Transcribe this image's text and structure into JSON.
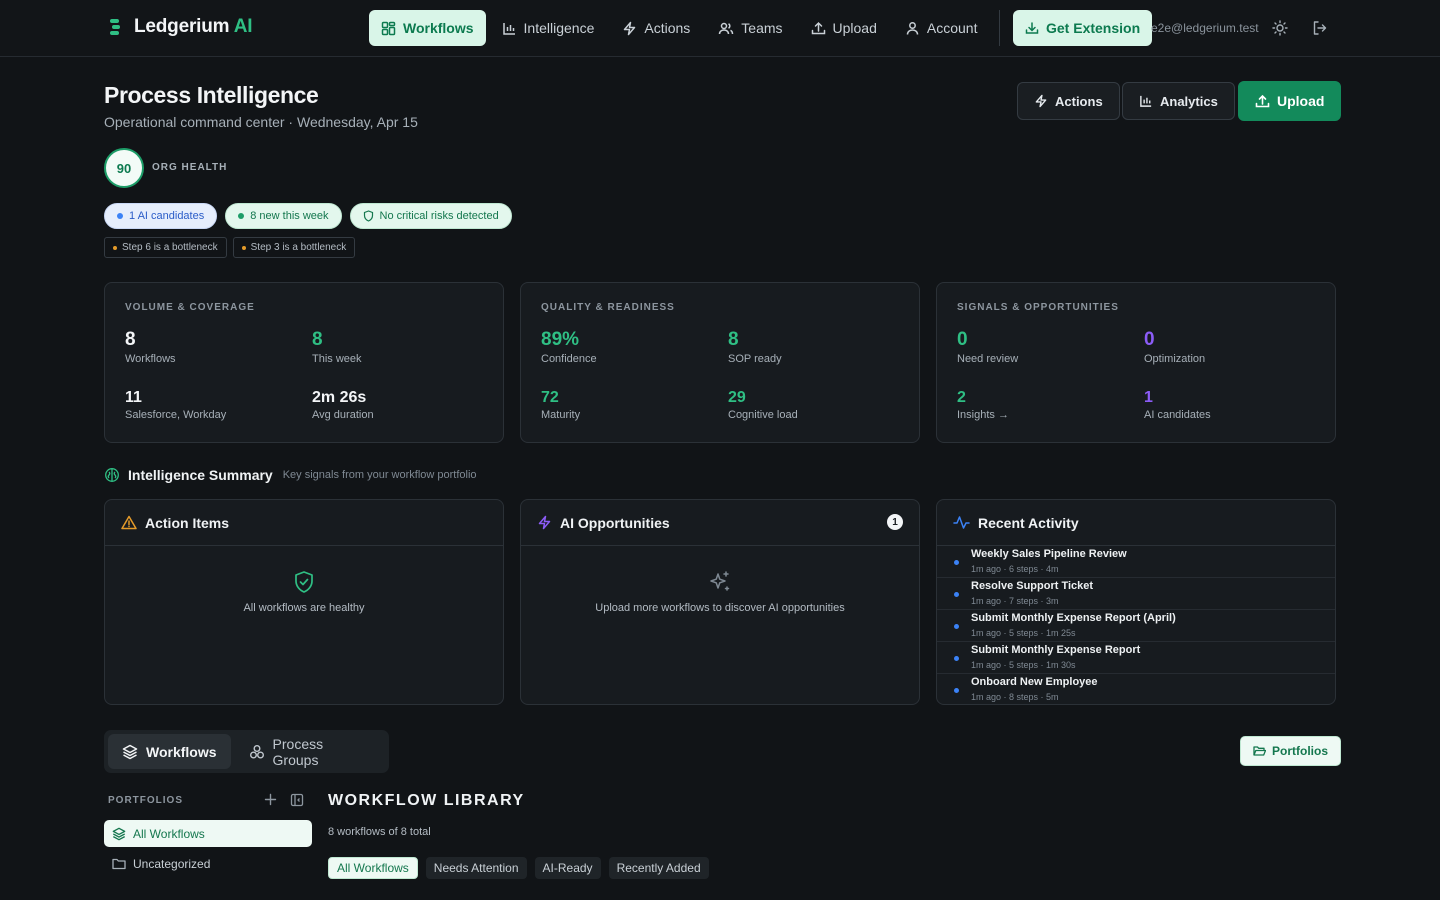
{
  "brand": {
    "name": "Ledgerium",
    "suffix": "AI"
  },
  "nav": {
    "items": [
      {
        "label": "Workflows",
        "icon": "grid-icon",
        "active": true
      },
      {
        "label": "Intelligence",
        "icon": "bar-chart-icon"
      },
      {
        "label": "Actions",
        "icon": "bolt-icon"
      },
      {
        "label": "Teams",
        "icon": "users-icon"
      },
      {
        "label": "Upload",
        "icon": "upload-icon"
      },
      {
        "label": "Account",
        "icon": "user-icon"
      }
    ],
    "extension_label": "Get Extension",
    "user_email": "e2e@ledgerium.test"
  },
  "page": {
    "title": "Process Intelligence",
    "subtitle": "Operational command center · Wednesday, Apr 15",
    "buttons": {
      "actions": "Actions",
      "analytics": "Analytics",
      "upload": "Upload"
    },
    "health": {
      "score": "90",
      "label": "ORG HEALTH"
    },
    "chips": [
      "1 AI candidates",
      "8 new this week",
      "No critical risks detected"
    ],
    "tags": [
      "Step 6 is a bottleneck",
      "Step 3 is a bottleneck"
    ]
  },
  "metrics": {
    "volume": {
      "title": "VOLUME & COVERAGE",
      "items": [
        {
          "value": "8",
          "label": "Workflows"
        },
        {
          "value": "8",
          "label": "This week"
        },
        {
          "value": "11",
          "label": "Salesforce, Workday"
        },
        {
          "value": "2m 26s",
          "label": "Avg duration"
        }
      ]
    },
    "quality": {
      "title": "QUALITY & READINESS",
      "items": [
        {
          "value": "89%",
          "label": "Confidence"
        },
        {
          "value": "8",
          "label": "SOP ready"
        },
        {
          "value": "72",
          "label": "Maturity"
        },
        {
          "value": "29",
          "label": "Cognitive load"
        }
      ]
    },
    "signals": {
      "title": "SIGNALS & OPPORTUNITIES",
      "items": [
        {
          "value": "0",
          "label": "Need review"
        },
        {
          "value": "0",
          "label": "Optimization"
        },
        {
          "value": "2",
          "label": "Insights →"
        },
        {
          "value": "1",
          "label": "AI candidates"
        }
      ]
    }
  },
  "summary": {
    "title": "Intelligence Summary",
    "subtitle": "Key signals from your workflow portfolio",
    "action_items": {
      "title": "Action Items",
      "message": "All workflows are healthy"
    },
    "ai_opps": {
      "title": "AI Opportunities",
      "badge": "1",
      "message": "Upload more workflows to discover AI opportunities"
    },
    "recent": {
      "title": "Recent Activity",
      "rows": [
        {
          "title": "Weekly Sales Pipeline Review",
          "meta": "1m ago · 6 steps · 4m"
        },
        {
          "title": "Resolve Support Ticket",
          "meta": "1m ago · 7 steps · 3m"
        },
        {
          "title": "Submit Monthly Expense Report (April)",
          "meta": "1m ago · 5 steps · 1m 25s"
        },
        {
          "title": "Submit Monthly Expense Report",
          "meta": "1m ago · 5 steps · 1m 30s"
        },
        {
          "title": "Onboard New Employee",
          "meta": "1m ago · 8 steps · 5m"
        }
      ]
    }
  },
  "library": {
    "tabs": [
      "Workflows",
      "Process Groups"
    ],
    "portfolios_button": "Portfolios",
    "portfolios_label": "PORTFOLIOS",
    "portfolio_items": [
      "All Workflows",
      "Uncategorized"
    ],
    "title": "WORKFLOW LIBRARY",
    "subtitle": "8 workflows of 8 total",
    "filters": [
      "All Workflows",
      "Needs Attention",
      "AI-Ready",
      "Recently Added"
    ]
  },
  "colors": {
    "accent": "#138a5b",
    "accent_light": "#d9f5e8",
    "green_value": "#2fbf84",
    "purple_value": "#8b5cf6",
    "blue_dot": "#3b82f6",
    "warn": "#e49b2a"
  }
}
